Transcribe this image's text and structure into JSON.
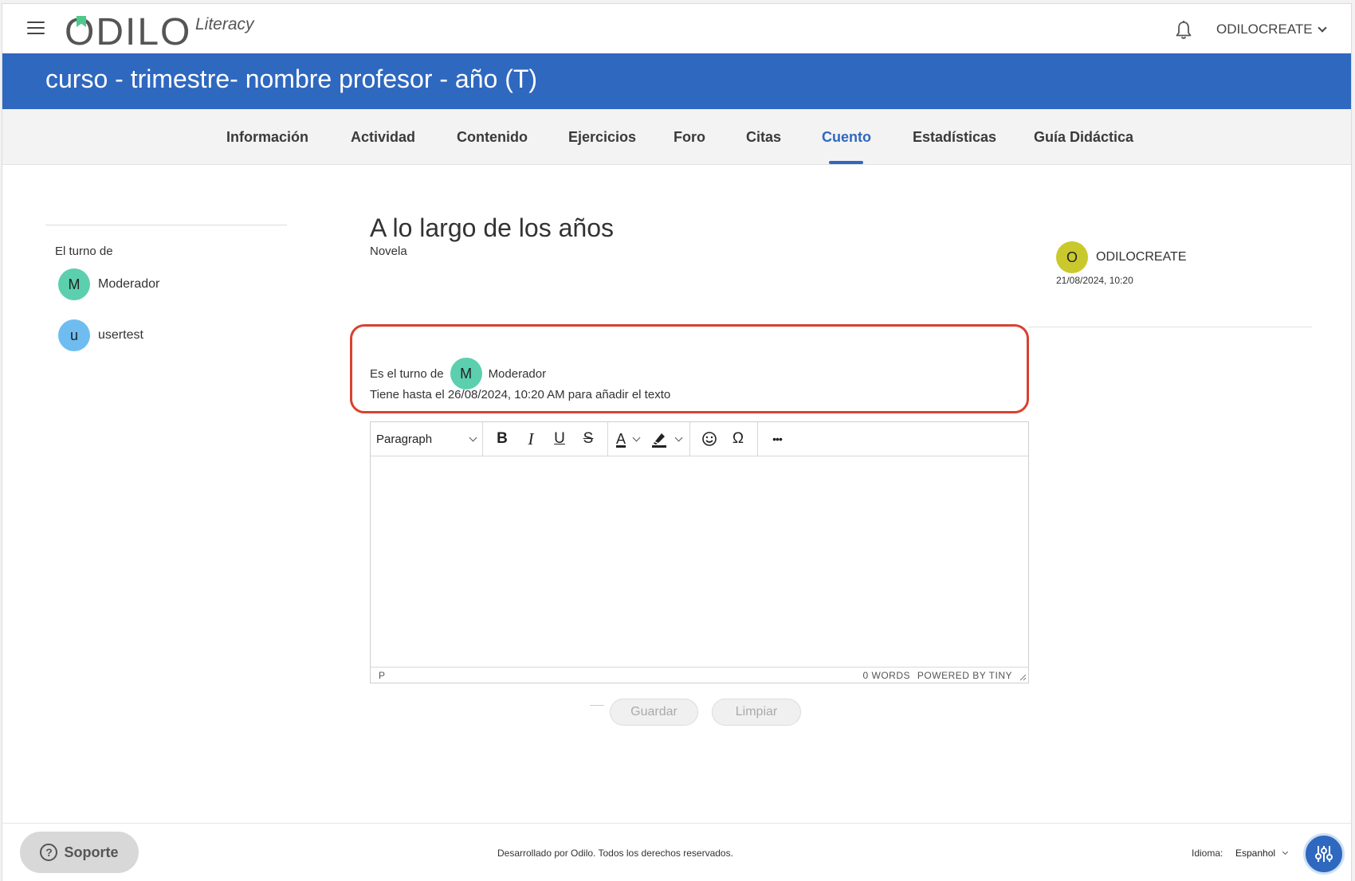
{
  "header": {
    "logo_text": "ODILO",
    "logo_sub": "Literacy",
    "user_name": "ODILOCREATE"
  },
  "banner": {
    "title": "curso - trimestre- nombre profesor - año (T)"
  },
  "tabs": [
    {
      "label": "Información",
      "active": false
    },
    {
      "label": "Actividad",
      "active": false
    },
    {
      "label": "Contenido",
      "active": false
    },
    {
      "label": "Ejercicios",
      "active": false
    },
    {
      "label": "Foro",
      "active": false
    },
    {
      "label": "Citas",
      "active": false
    },
    {
      "label": "Cuento",
      "active": true
    },
    {
      "label": "Estadísticas",
      "active": false
    },
    {
      "label": "Guía Didáctica",
      "active": false
    }
  ],
  "sidebar": {
    "label": "El turno de",
    "participants": [
      {
        "initial": "M",
        "name": "Moderador",
        "color": "#5ccfae"
      },
      {
        "initial": "u",
        "name": "usertest",
        "color": "#6fbdf0"
      }
    ]
  },
  "story": {
    "title": "A lo largo de los años",
    "genre": "Novela",
    "author_initial": "O",
    "author_name": "ODILOCREATE",
    "author_color": "#c9c92e",
    "date": "21/08/2024, 10:20"
  },
  "turn": {
    "prefix": "Es el turno de",
    "user_initial": "M",
    "user_name": "Moderador",
    "user_color": "#5ccfae",
    "deadline": "Tiene hasta el 26/08/2024, 10:20 AM para añadir el texto",
    "highlight_color": "#d9412f"
  },
  "editor": {
    "format": "Paragraph",
    "btn_bold": "B",
    "btn_italic": "I",
    "btn_underline": "U",
    "btn_strike": "S",
    "btn_forecolor": "A",
    "btn_special": "Ω",
    "btn_more": "•••",
    "path": "P",
    "words": "0 WORDS",
    "powered": "POWERED BY TINY"
  },
  "actions": {
    "save": "Guardar",
    "clear": "Limpiar"
  },
  "footer": {
    "support": "Soporte",
    "support_icon": "?",
    "copyright": "Desarrollado por Odilo. Todos los derechos reservados.",
    "lang_label": "Idioma:",
    "lang_value": "Espanhol"
  },
  "colors": {
    "brand": "#2f68bf"
  }
}
